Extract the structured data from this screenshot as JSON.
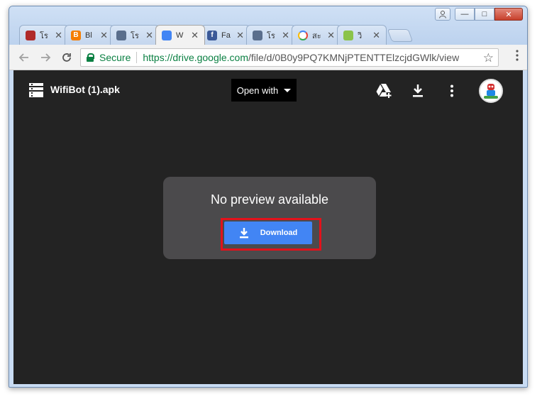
{
  "window_controls": {
    "minimize": "—",
    "maximize": "□",
    "close": "✕"
  },
  "tabs": [
    {
      "label": "โร",
      "icon": "robot-figure-icon",
      "color": "#b02a2a",
      "active": false
    },
    {
      "label": "Bl",
      "icon": "blogger-icon",
      "color": "#f57d00",
      "active": false
    },
    {
      "label": "โร",
      "icon": "robot-face-icon",
      "color": "#5a6e8c",
      "active": false
    },
    {
      "label": "W",
      "icon": "google-docs-file-icon",
      "color": "#4285f4",
      "active": true
    },
    {
      "label": "Fa",
      "icon": "facebook-icon",
      "color": "#3b5998",
      "active": false
    },
    {
      "label": "โร",
      "icon": "robot-face-icon",
      "color": "#5a6e8c",
      "active": false
    },
    {
      "label": "สะ",
      "icon": "google-icon",
      "color": "#ffffff",
      "active": false
    },
    {
      "label": "วิ",
      "icon": "android-icon",
      "color": "#8bc34a",
      "active": false
    }
  ],
  "address_bar": {
    "secure_label": "Secure",
    "url_host": "https://drive.google.com",
    "url_path": "/file/d/0B0y9PQ7KMNjPTENTTElzcjdGWlk/view"
  },
  "viewer": {
    "filename": "WifiBot (1).apk",
    "open_with_label": "Open with",
    "preview_message": "No preview available",
    "download_label": "Download"
  },
  "colors": {
    "viewer_bg": "#232323",
    "card_bg": "#4b4a4c",
    "download_button": "#4285f4",
    "highlight": "#e3121b",
    "secure_green": "#0b8043"
  }
}
